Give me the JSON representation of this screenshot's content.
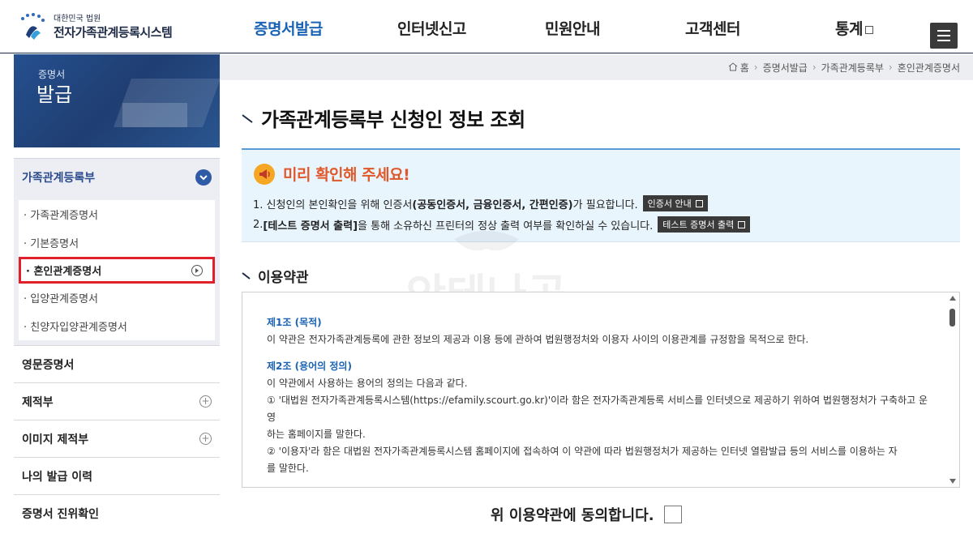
{
  "header": {
    "logo_sub": "대한민국 법원",
    "logo_main": "전자가족관계등록시스템",
    "nav": [
      {
        "label": "증명서발급",
        "active": true
      },
      {
        "label": "인터넷신고",
        "active": false
      },
      {
        "label": "민원안내",
        "active": false
      },
      {
        "label": "고객센터",
        "active": false
      },
      {
        "label": "통계",
        "active": false,
        "external": true
      }
    ],
    "menu_icon": "hamburger-icon"
  },
  "side_banner": {
    "small": "증명서",
    "big": "발급"
  },
  "sidebar": {
    "open_category": {
      "label": "가족관계등록부",
      "icon": "chevron-down-icon"
    },
    "sub_items": [
      {
        "label": "· 가족관계증명서"
      },
      {
        "label": "· 기본증명서"
      },
      {
        "label": "· 혼인관계증명서",
        "active": true
      },
      {
        "label": "· 입양관계증명서"
      },
      {
        "label": "· 친양자입양관계증명서"
      }
    ],
    "categories": [
      {
        "label": "영문증명서",
        "plus": false
      },
      {
        "label": "제적부",
        "plus": true
      },
      {
        "label": "이미지 제적부",
        "plus": true
      },
      {
        "label": "나의 발급 이력",
        "plus": false
      },
      {
        "label": "증명서 진위확인",
        "plus": false
      }
    ]
  },
  "breadcrumb": {
    "home": "홈",
    "items": [
      "증명서발급",
      "가족관계등록부",
      "혼인관계증명서"
    ]
  },
  "page": {
    "title": "가족관계등록부 신청인 정보 조회"
  },
  "notice": {
    "title": "미리 확인해 주세요!",
    "line1_prefix": "1. 신청인의 본인확인을 위해 인증서",
    "line1_bold": "(공동인증서, 금융인증서, 간편인증)",
    "line1_suffix": "가 필요합니다.",
    "line1_button": "인증서 안내",
    "line2_prefix": "2. ",
    "line2_bold": "[테스트 증명서 출력]",
    "line2_suffix": "을 통해 소유하신 프린터의 정상 출력 여부를 확인하실 수 있습니다.",
    "line2_button": "테스트 증명서 출력"
  },
  "terms": {
    "title": "이용약관",
    "art1_title": "제1조 (목적)",
    "art1_body": "이 약관은 전자가족관계등록에 관한 정보의 제공과 이용 등에 관하여 법원행정처와 이용자 사이의 이용관계를 규정함을 목적으로 한다.",
    "art2_title": "제2조 (용어의 정의)",
    "art2_body": "이 약관에서 사용하는 용어의 정의는 다음과 같다.",
    "art2_item1a": "① '대법원 전자가족관계등록시스템(https://efamily.scourt.go.kr)'이라 함은 전자가족관계등록 서비스를 인터넷으로 제공하기 위하여 법원행정처가 구축하고 운영",
    "art2_item1b": "하는 홈페이지를 말한다.",
    "art2_item2a": "② '이용자'라 함은 대법원 전자가족관계등록시스템 홈페이지에 접속하여 이 약관에 따라 법원행정처가 제공하는 인터넷 열람발급 등의 서비스를 이용하는 자",
    "art2_item2b": "를 말한다."
  },
  "agree": {
    "label": "위 이용약관에 동의합니다."
  },
  "watermark": "안테나곰"
}
